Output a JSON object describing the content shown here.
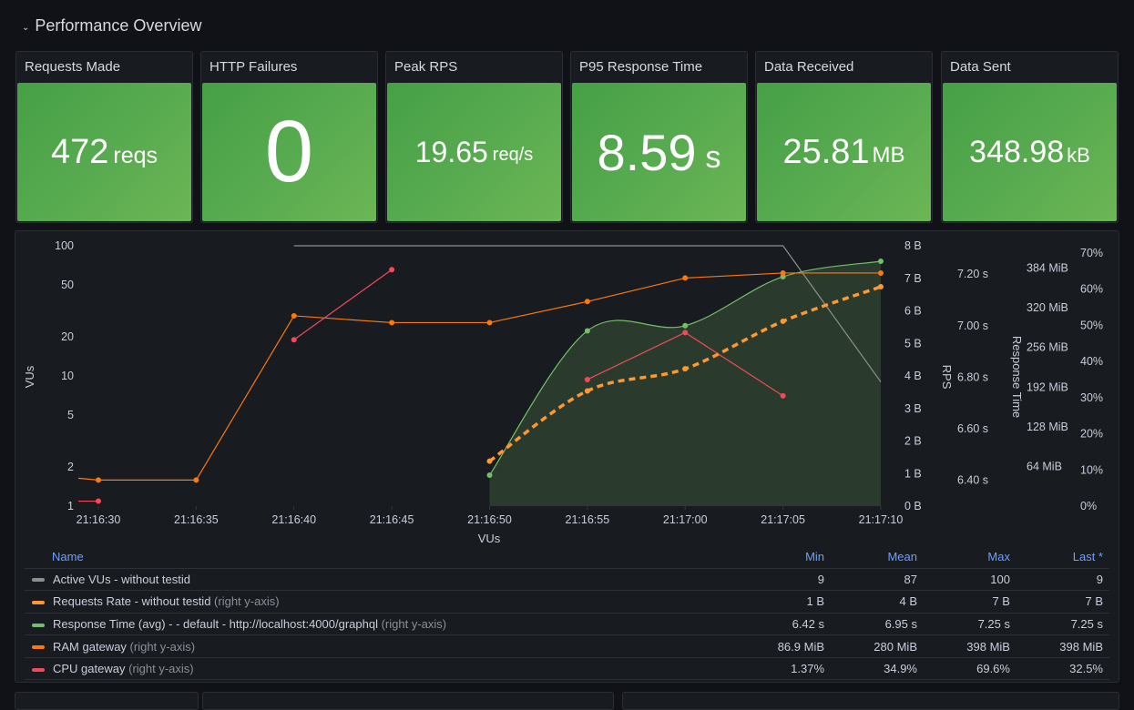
{
  "row": {
    "title": "Performance Overview",
    "icon": "chevron-down-icon"
  },
  "stats": [
    {
      "title": "Requests Made",
      "value": "472",
      "unit": "reqs"
    },
    {
      "title": "HTTP Failures",
      "value": "0",
      "unit": ""
    },
    {
      "title": "Peak RPS",
      "value": "19.65",
      "unit": "req/s"
    },
    {
      "title": "P95 Response Time",
      "value": "8.59",
      "unit": "s"
    },
    {
      "title": "Data Received",
      "value": "25.81",
      "unit": "MB"
    },
    {
      "title": "Data Sent",
      "value": "348.98",
      "unit": "kB"
    }
  ],
  "colors": {
    "stat_green": "#56a64b",
    "vus": "#8e8e8e",
    "requests_rate": "#ff9830",
    "response_time": "#73bf69",
    "ram": "#ff780a",
    "cpu": "#f2495c",
    "legend_header": "#6e9fff"
  },
  "chart_data": {
    "type": "line",
    "xlabel": "VUs",
    "x": [
      "21:16:30",
      "21:16:35",
      "21:16:40",
      "21:16:45",
      "21:16:50",
      "21:16:55",
      "21:17:00",
      "21:17:05",
      "21:17:10"
    ],
    "axes": {
      "left": {
        "label": "VUs",
        "scale": "log",
        "ticks": [
          "1",
          "2",
          "5",
          "10",
          "20",
          "50",
          "100"
        ],
        "range": [
          1,
          100
        ]
      },
      "right1": {
        "label": "",
        "ticks": [
          "0 B",
          "1 B",
          "2 B",
          "3 B",
          "4 B",
          "5 B",
          "6 B",
          "7 B",
          "8 B"
        ],
        "range": [
          0,
          8
        ]
      },
      "right2": {
        "label": "RPS",
        "ticks": [
          "6.40 s",
          "6.60 s",
          "6.80 s",
          "7.00 s",
          "7.20 s"
        ],
        "range": [
          6.3,
          7.31
        ]
      },
      "right3": {
        "label": "Response Time",
        "ticks": [
          "64 MiB",
          "128 MiB",
          "192 MiB",
          "256 MiB",
          "320 MiB",
          "384 MiB"
        ],
        "range": [
          0,
          420
        ]
      },
      "right4": {
        "label": "",
        "ticks": [
          "0%",
          "10%",
          "20%",
          "30%",
          "40%",
          "50%",
          "60%",
          "70%"
        ],
        "range": [
          0,
          72
        ]
      }
    },
    "series": [
      {
        "name": "Active VUs - without testid",
        "axis": "left",
        "color": "#8e8e8e",
        "values": [
          null,
          null,
          100,
          100,
          100,
          100,
          100,
          100,
          9
        ]
      },
      {
        "name": "Requests Rate - without testid",
        "axis": "right1",
        "color": "#ff9830",
        "dashed": true,
        "values": [
          null,
          null,
          null,
          null,
          1.38,
          3.54,
          4.22,
          5.68,
          6.74
        ]
      },
      {
        "name": "Response Time (avg) - - default - http://localhost:4000/graphql",
        "axis": "right2",
        "color": "#73bf69",
        "fill": true,
        "values": [
          null,
          null,
          null,
          null,
          6.42,
          6.98,
          7.0,
          7.19,
          7.25
        ]
      },
      {
        "name": "RAM gateway",
        "axis": "right3",
        "color": "#ff780a",
        "values": [
          42,
          42,
          307,
          296,
          296,
          330,
          368,
          376,
          376
        ]
      },
      {
        "name": "CPU gateway",
        "axis": "right4",
        "color": "#f2495c",
        "values": [
          1.37,
          null,
          46.0,
          65.4,
          null,
          35.0,
          48.0,
          30.5,
          null
        ]
      }
    ]
  },
  "legend": {
    "headers": {
      "name": "Name",
      "min": "Min",
      "mean": "Mean",
      "max": "Max",
      "last": "Last *"
    },
    "rows": [
      {
        "name": "Active VUs - without testid",
        "note": "",
        "color": "#8e8e8e",
        "min": "9",
        "mean": "87",
        "max": "100",
        "last": "9"
      },
      {
        "name": "Requests Rate - without testid",
        "note": "(right y-axis)",
        "color": "#ff9830",
        "min": "1 B",
        "mean": "4 B",
        "max": "7 B",
        "last": "7 B"
      },
      {
        "name": "Response Time (avg) - - default - http://localhost:4000/graphql",
        "note": "(right y-axis)",
        "color": "#73bf69",
        "min": "6.42 s",
        "mean": "6.95 s",
        "max": "7.25 s",
        "last": "7.25 s"
      },
      {
        "name": "RAM gateway",
        "note": "(right y-axis)",
        "color": "#ff780a",
        "min": "86.9 MiB",
        "mean": "280 MiB",
        "max": "398 MiB",
        "last": "398 MiB"
      },
      {
        "name": "CPU gateway",
        "note": "(right y-axis)",
        "color": "#f2495c",
        "min": "1.37%",
        "mean": "34.9%",
        "max": "69.6%",
        "last": "32.5%"
      }
    ]
  }
}
